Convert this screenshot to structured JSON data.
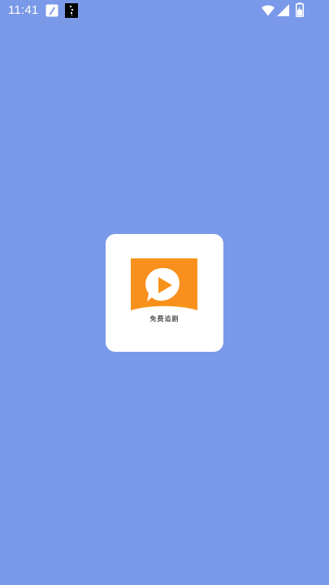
{
  "status_bar": {
    "time": "11:41",
    "icons": [
      "notification-edit-icon",
      "notification-app-icon",
      "wifi-icon",
      "signal-icon",
      "battery-charging-icon"
    ]
  },
  "splash": {
    "app_name": "免费追剧",
    "logo_icon": "play-icon"
  },
  "colors": {
    "background": "#7a99e8",
    "status_icons": "#ffffff",
    "card": "#ffffff",
    "logo_orange": "#f7931a",
    "play_bubble": "#ffffff"
  }
}
